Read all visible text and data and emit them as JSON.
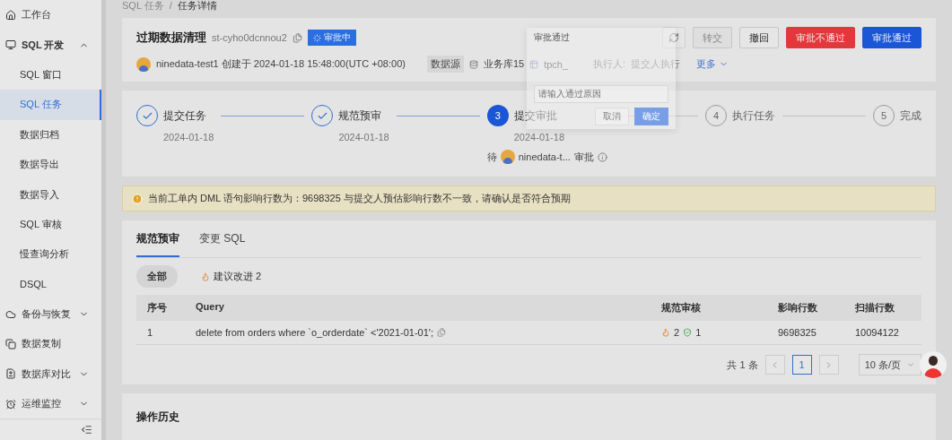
{
  "sidebar": {
    "items": [
      {
        "label": "工作台",
        "selected": false
      },
      {
        "label": "SQL 开发",
        "selected": false,
        "expanded": true,
        "children": [
          {
            "label": "SQL 窗口",
            "selected": false
          },
          {
            "label": "SQL 任务",
            "selected": true
          },
          {
            "label": "数据归档",
            "selected": false
          },
          {
            "label": "数据导出",
            "selected": false
          },
          {
            "label": "数据导入",
            "selected": false
          },
          {
            "label": "SQL 审核",
            "selected": false
          },
          {
            "label": "慢查询分析",
            "selected": false
          },
          {
            "label": "DSQL",
            "selected": false
          }
        ]
      },
      {
        "label": "备份与恢复",
        "selected": false,
        "expanded": false
      },
      {
        "label": "数据复制",
        "selected": false
      },
      {
        "label": "数据库对比",
        "selected": false,
        "expanded": false
      },
      {
        "label": "运维监控",
        "selected": false,
        "expanded": false
      }
    ]
  },
  "breadcrumb": {
    "items": [
      "SQL 任务",
      "任务详情"
    ],
    "separator": "/"
  },
  "task": {
    "title": "过期数据清理",
    "id": "st-cyho0dcnnou2",
    "status": "审批中",
    "user": "ninedata-test1",
    "created": "创建于 2024-01-18 15:48:00(UTC +08:00)",
    "datasource_label": "数据源",
    "database": "业务库15",
    "schema": "tpch_",
    "executor_label": "执行人:",
    "executor": "提交人执行",
    "more": "更多"
  },
  "actions": [
    {
      "kind": "icon"
    },
    {
      "kind": "default",
      "label": "转交",
      "disabled": true
    },
    {
      "kind": "default",
      "label": "撤回",
      "disabled": false
    },
    {
      "kind": "danger",
      "label": "审批不通过"
    },
    {
      "kind": "primary",
      "label": "审批通过"
    }
  ],
  "steps": [
    {
      "done": true,
      "active": false,
      "title": "提交任务",
      "date": "2024-01-18"
    },
    {
      "done": true,
      "active": false,
      "title": "规范预审",
      "date": "2024-01-18"
    },
    {
      "done": false,
      "active": true,
      "number": "3",
      "title": "提交审批",
      "date": "2024-01-18",
      "waiting": {
        "prefix": "待",
        "user": "ninedata-t...",
        "suffix": "审批"
      }
    },
    {
      "done": false,
      "active": false,
      "number": "4",
      "title": "执行任务"
    },
    {
      "done": false,
      "active": false,
      "number": "5",
      "title": "完成"
    }
  ],
  "alert": {
    "text": "当前工单内 DML 语句影响行数为：9698325 与提交人预估影响行数不一致，请确认是否符合预期"
  },
  "tabs": [
    {
      "label": "规范预审",
      "selected": true
    },
    {
      "label": "变更 SQL",
      "selected": false
    }
  ],
  "filters": [
    {
      "label": "全部",
      "selected": true
    },
    {
      "label": "建议改进 2",
      "selected": false
    }
  ],
  "table": {
    "columns": [
      "序号",
      "Query",
      "规范审核",
      "影响行数",
      "扫描行数"
    ],
    "rows": [
      {
        "index": "1",
        "query": "delete from orders where `o_orderdate` <'2021-01-01';",
        "review_warn": "2",
        "review_pass": "1",
        "affected": "9698325",
        "scanned": "10094122"
      }
    ]
  },
  "pagination": {
    "total": "共 1 条",
    "pages": [
      {
        "label": "1",
        "selected": true
      }
    ],
    "page_size": "10 条/页"
  },
  "history": {
    "title": "操作历史"
  },
  "popover": {
    "title": "审批通过",
    "placeholder": "请输入通过原因",
    "cancel": "取消",
    "ok": "确定"
  }
}
